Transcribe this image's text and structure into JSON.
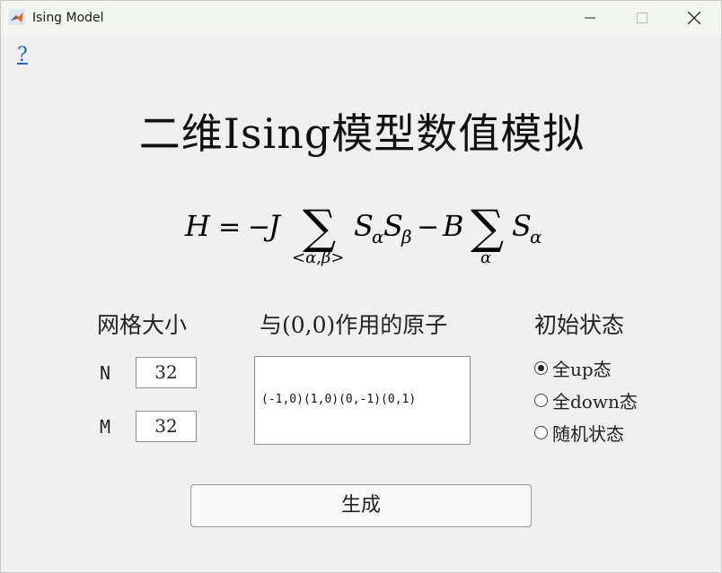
{
  "window": {
    "title": "Ising Model"
  },
  "icons": {
    "app": "matlab-icon",
    "minimize": "minimize-icon",
    "maximize": "maximize-icon",
    "close": "close-icon"
  },
  "help": {
    "label": "?"
  },
  "header": {
    "title": "二维Ising模型数值模拟"
  },
  "formula": {
    "lhs": "H",
    "equals": "=",
    "minus": "−",
    "coupling": "J",
    "sum_symbol": "∑",
    "sum1_subscript": "<α,β>",
    "spin": "S",
    "sub_alpha": "α",
    "sub_beta": "β",
    "field": "B"
  },
  "grid": {
    "heading": "网格大小",
    "n_label": "N",
    "n_value": "32",
    "m_label": "M",
    "m_value": "32"
  },
  "neighbors": {
    "heading": "与(0,0)作用的原子",
    "value": "(-1,0)(1,0)(0,-1)(0,1)"
  },
  "initial_state": {
    "heading": "初始状态",
    "options": [
      {
        "label": "全up态",
        "selected": true
      },
      {
        "label": "全down态",
        "selected": false
      },
      {
        "label": "随机状态",
        "selected": false
      }
    ]
  },
  "actions": {
    "generate_label": "生成"
  },
  "colors": {
    "link": "#1e64d4",
    "background": "#f0f0f0",
    "titlebar": "#f3f6f0"
  }
}
